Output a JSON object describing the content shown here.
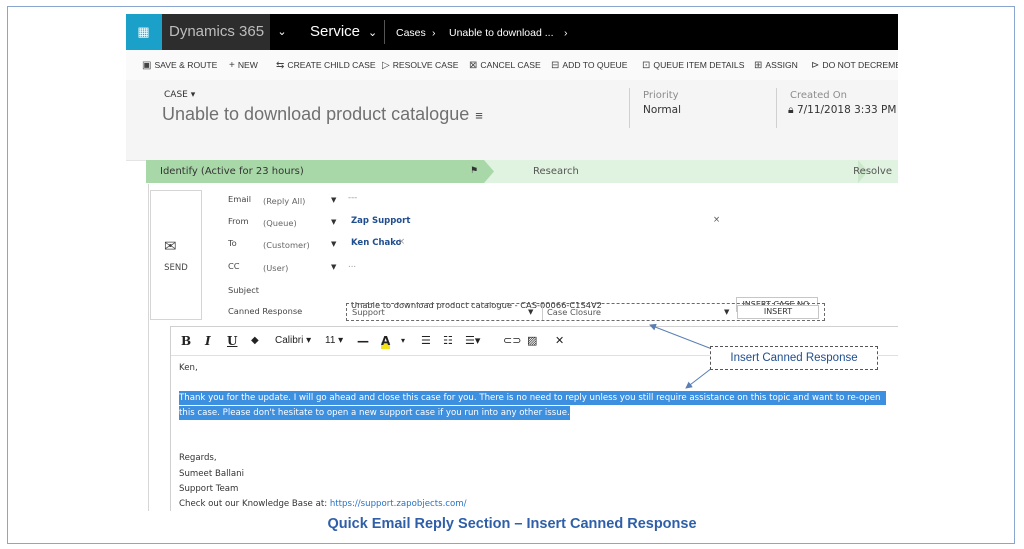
{
  "topnav": {
    "waffle_icon": "grid-icon",
    "app_name": "Dynamics 365",
    "module": "Service",
    "breadcrumb": [
      "Cases",
      "Unable to download ..."
    ]
  },
  "command_bar": [
    {
      "label": "SAVE & ROUTE",
      "icon": "save-route-icon"
    },
    {
      "label": "NEW",
      "icon": "plus-icon"
    },
    {
      "label": "CREATE CHILD CASE",
      "icon": "child-case-icon"
    },
    {
      "label": "RESOLVE CASE",
      "icon": "resolve-icon"
    },
    {
      "label": "CANCEL CASE",
      "icon": "cancel-icon"
    },
    {
      "label": "ADD TO QUEUE",
      "icon": "queue-icon"
    },
    {
      "label": "QUEUE ITEM DETAILS",
      "icon": "queue-details-icon"
    },
    {
      "label": "ASSIGN",
      "icon": "assign-icon"
    },
    {
      "label": "DO NOT DECREME",
      "icon": "decrement-icon"
    }
  ],
  "header": {
    "entity_label": "CASE",
    "record_title": "Unable to download product catalogue",
    "priority_label": "Priority",
    "priority_value": "Normal",
    "created_on_label": "Created On",
    "created_on_value": "7/11/2018  3:33 PM"
  },
  "process": {
    "active_stage": "Identify (Active for 23 hours)",
    "stage_2": "Research",
    "stage_3": "Resolve"
  },
  "email": {
    "send_label": "SEND",
    "rows": {
      "email": {
        "label": "Email",
        "value": "(Reply All)",
        "extra": "---"
      },
      "from": {
        "label": "From",
        "value": "(Queue)",
        "recipient": "Zap Support"
      },
      "to": {
        "label": "To",
        "value": "(Customer)",
        "recipient": "Ken Chako"
      },
      "cc": {
        "label": "CC",
        "value": "(User)",
        "extra": "..."
      }
    },
    "subject_label": "Subject",
    "subject_value": "Unable to download product catalogue - CAS-00066-C1S4V2",
    "insert_case_no": "INSERT CASE NO.",
    "canned_label": "Canned Response",
    "canned_category": "Support",
    "canned_template": "Case Closure",
    "insert_button": "INSERT"
  },
  "editor": {
    "font": "Calibri",
    "size": "11",
    "greeting": "Ken,",
    "highlight_line1": "Thank you for the update. I will go ahead and close this case for you. There is no need to reply unless you still require assistance on this topic and want to re-open",
    "highlight_line2": "this case. Please don't hesitate to open a new support case if you run into any other issue.",
    "regards": "Regards,",
    "name": "Sumeet Ballani",
    "team": "Support Team",
    "kb_prefix": "Check out our Knowledge Base at:",
    "kb_link": "https://support.zapobjects.com/"
  },
  "callout": "Insert Canned Response",
  "caption": "Quick Email Reply Section – Insert Canned Response",
  "colors": {
    "accent": "#1aa0c9",
    "stage_active": "#a9d8a8",
    "highlight": "#3d8fe0",
    "caption": "#2e5fa8"
  }
}
